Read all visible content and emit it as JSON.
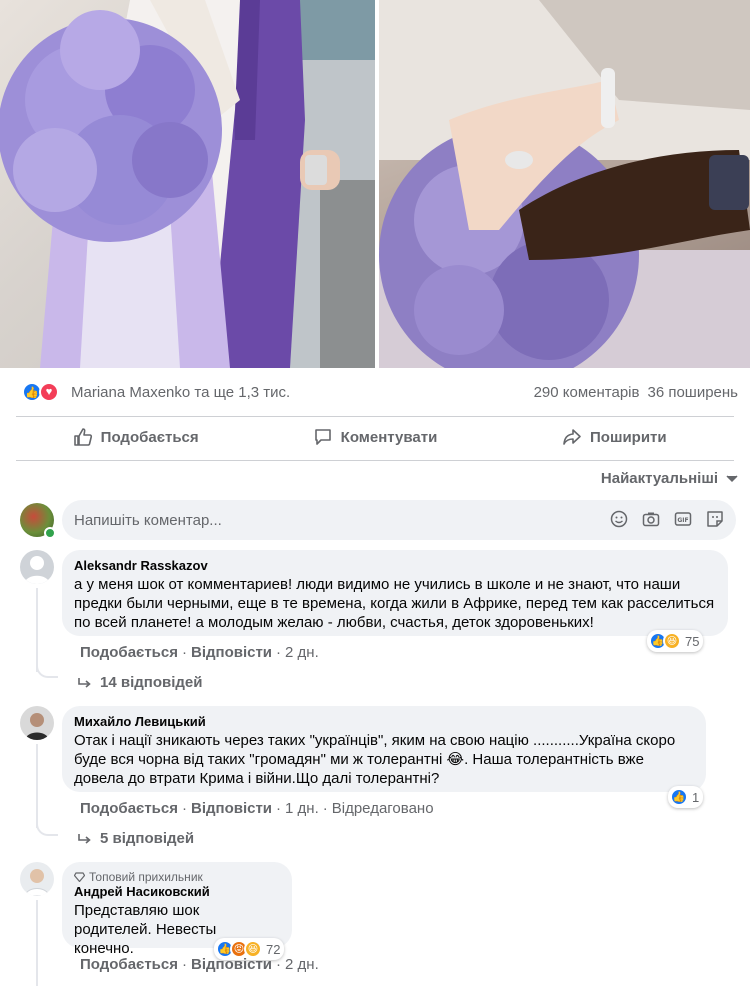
{
  "summary": {
    "names": "Mariana Maxenko та ще 1,3 тис.",
    "comments": "290 коментарів",
    "shares": "36 поширень"
  },
  "actions": {
    "like": "Подобається",
    "comment": "Коментувати",
    "share": "Поширити"
  },
  "sort_label": "Найактуальніші",
  "composer": {
    "placeholder": "Напишіть коментар..."
  },
  "comments": [
    {
      "author": "Aleksandr Rasskazov",
      "text": "а у меня шок от комментариев! люди видимо не учились в школе и не знают, что наши предки были черными, еще в те времена, когда жили в Африке, перед тем как расселиться по всей планете! а молодым желаю - любви, счастья, деток здоровеньких!",
      "like": "Подобається",
      "reply": "Відповісти",
      "time": "2 дн.",
      "reactions": "75",
      "replies": "14 відповідей"
    },
    {
      "author": "Михайло Левицький",
      "text": "Отак і нації зникають через таких \"українців\", яким на свою націю ...........Україна скоро буде вся чорна від таких \"громадян\" ми ж толерантні 😂. Наша толерантність вже довела до втрати Крима і війни.Що далі толерантні?",
      "like": "Подобається",
      "reply": "Відповісти",
      "time": "1 дн.",
      "edited": "Відредаговано",
      "reactions": "1",
      "replies": "5 відповідей"
    },
    {
      "badge": "Топовий прихильник",
      "author": "Андрей Насиковский",
      "text": "Представляю шок родителей. Невесты конечно.",
      "like": "Подобається",
      "reply": "Відповісти",
      "time": "2 дн.",
      "reactions": "72"
    }
  ]
}
